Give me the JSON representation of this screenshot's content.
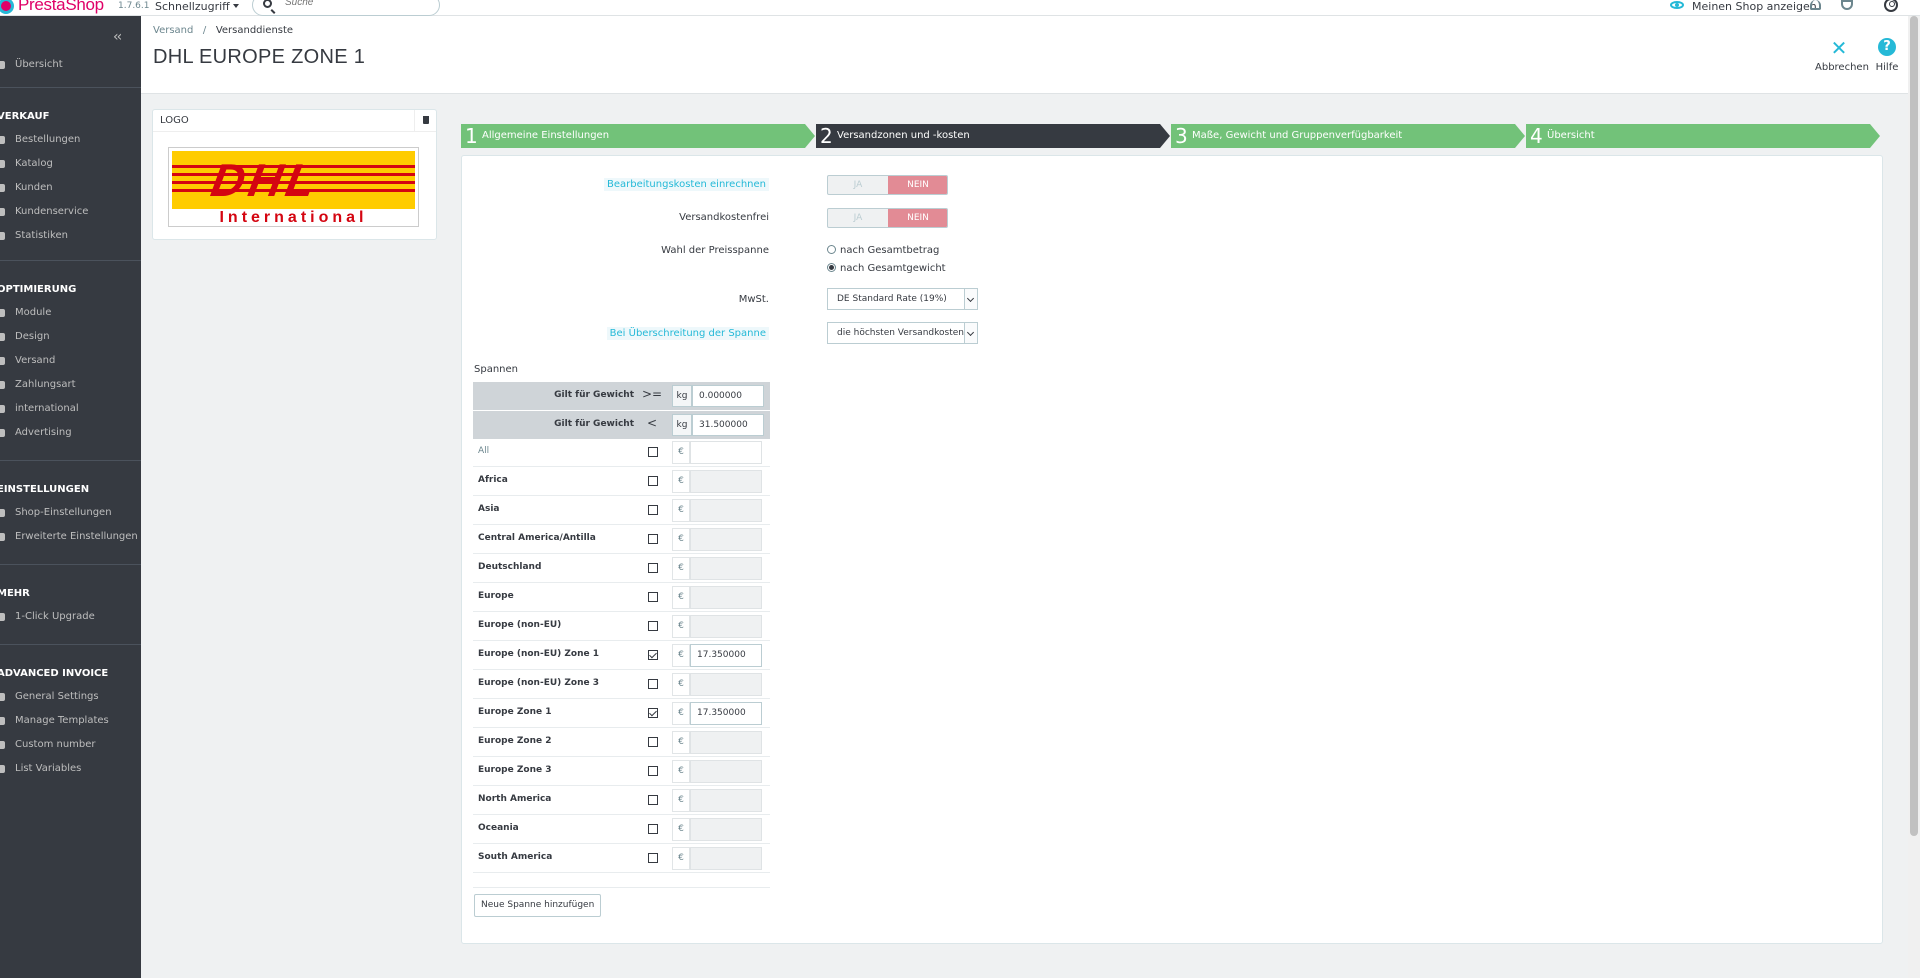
{
  "topbar": {
    "brand": "PrestaShop",
    "version": "1.7.6.1",
    "quick_access": "Schnellzugriff",
    "search_placeholder": "Suche",
    "view_shop": "Meinen Shop anzeigen"
  },
  "sidebar": {
    "overview": "Übersicht",
    "sections": [
      {
        "title": "VERKAUF",
        "items": [
          "Bestellungen",
          "Katalog",
          "Kunden",
          "Kundenservice",
          "Statistiken"
        ]
      },
      {
        "title": "OPTIMIERUNG",
        "items": [
          "Module",
          "Design",
          "Versand",
          "Zahlungsart",
          "international",
          "Advertising"
        ]
      },
      {
        "title": "EINSTELLUNGEN",
        "items": [
          "Shop-Einstellungen",
          "Erweiterte Einstellungen"
        ]
      },
      {
        "title": "MEHR",
        "items": [
          "1-Click Upgrade"
        ]
      },
      {
        "title": "ADVANCED INVOICE",
        "items": [
          "General Settings",
          "Manage Templates",
          "Custom number",
          "List Variables"
        ]
      }
    ]
  },
  "header": {
    "breadcrumb": [
      "Versand",
      "Versanddienste"
    ],
    "title": "DHL EUROPE ZONE 1",
    "cancel": "Abbrechen",
    "help": "Hilfe"
  },
  "logo_panel": {
    "title": "LOGO",
    "brand_word": "DHL",
    "brand_sub": "International"
  },
  "steps": [
    {
      "num": "1",
      "label": "Allgemeine Einstellungen"
    },
    {
      "num": "2",
      "label": "Versandzonen und -kosten"
    },
    {
      "num": "3",
      "label": "Maße, Gewicht und Gruppenverfügbarkeit"
    },
    {
      "num": "4",
      "label": "Übersicht"
    }
  ],
  "form": {
    "handling_label": "Bearbeitungskosten einrechnen",
    "free_label": "Versandkostenfrei",
    "yes": "JA",
    "no": "NEIN",
    "billing_label": "Wahl der Preisspanne",
    "billing_options": [
      "nach Gesamtbetrag",
      "nach Gesamtgewicht"
    ],
    "tax_label": "MwSt.",
    "tax_value": "DE Standard Rate (19%)",
    "outofrange_label": "Bei Überschreitung der Spanne",
    "outofrange_value": "die höchsten Versandkosten a"
  },
  "ranges": {
    "title": "Spannen",
    "rows": [
      {
        "label": "Gilt für Gewicht",
        "op": ">=",
        "unit": "kg",
        "value": "0.000000"
      },
      {
        "label": "Gilt für Gewicht",
        "op": "<",
        "unit": "kg",
        "value": "31.500000"
      }
    ],
    "currency": "€",
    "zones": [
      {
        "name": "All",
        "checked": false,
        "price": ""
      },
      {
        "name": "Africa",
        "checked": false,
        "price": ""
      },
      {
        "name": "Asia",
        "checked": false,
        "price": ""
      },
      {
        "name": "Central America/Antilla",
        "checked": false,
        "price": ""
      },
      {
        "name": "Deutschland",
        "checked": false,
        "price": ""
      },
      {
        "name": "Europe",
        "checked": false,
        "price": ""
      },
      {
        "name": "Europe (non-EU)",
        "checked": false,
        "price": ""
      },
      {
        "name": "Europe (non-EU) Zone 1",
        "checked": true,
        "price": "17.350000"
      },
      {
        "name": "Europe (non-EU) Zone 3",
        "checked": false,
        "price": ""
      },
      {
        "name": "Europe Zone 1",
        "checked": true,
        "price": "17.350000"
      },
      {
        "name": "Europe Zone 2",
        "checked": false,
        "price": ""
      },
      {
        "name": "Europe Zone 3",
        "checked": false,
        "price": ""
      },
      {
        "name": "North America",
        "checked": false,
        "price": ""
      },
      {
        "name": "Oceania",
        "checked": false,
        "price": ""
      },
      {
        "name": "South America",
        "checked": false,
        "price": ""
      }
    ],
    "add_button": "Neue Spanne hinzufügen"
  },
  "colors": {
    "accent": "#25b9d7",
    "brand": "#df0067",
    "step_done": "#72c279",
    "step_current": "#363a41",
    "no_active": "#e28b95"
  }
}
